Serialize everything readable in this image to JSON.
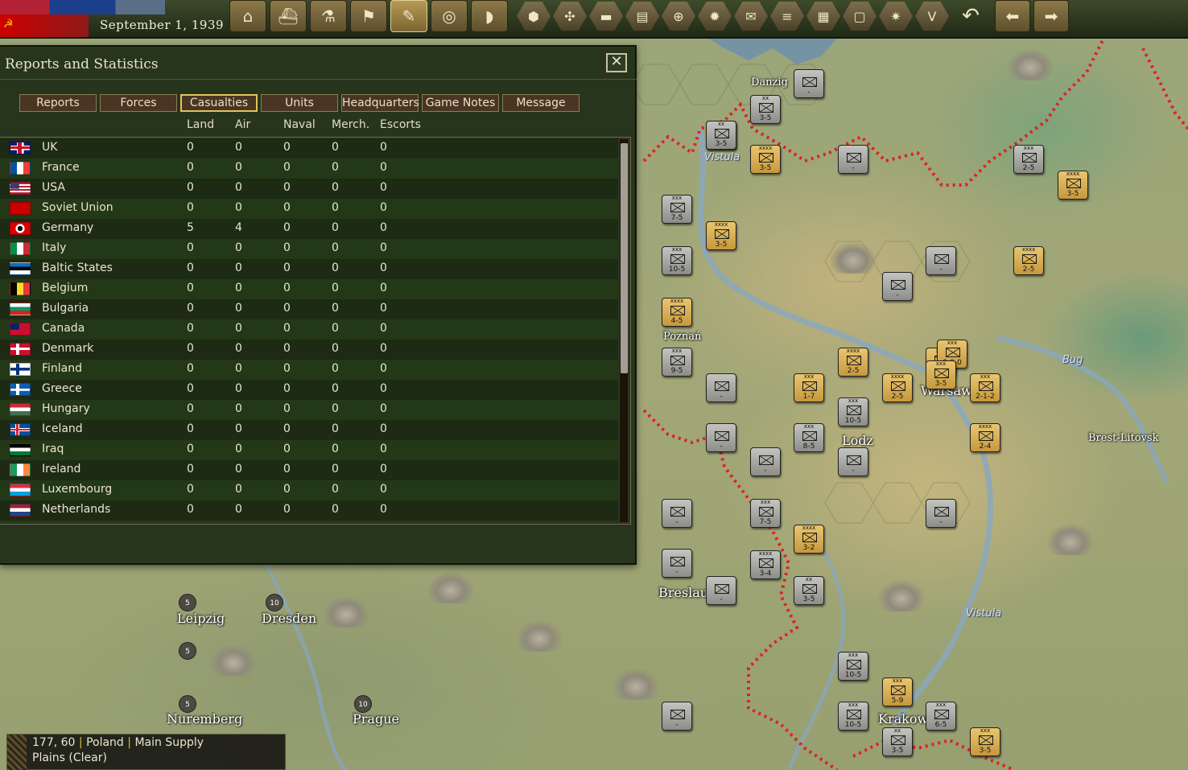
{
  "header": {
    "date": "September 1, 1939",
    "toolbar": [
      {
        "name": "production-button",
        "icon": "factory-icon",
        "glyph": "⌂"
      },
      {
        "name": "diplomacy-button",
        "icon": "ship-icon",
        "glyph": "⛴"
      },
      {
        "name": "research-button",
        "icon": "microscope-icon",
        "glyph": "⚗"
      },
      {
        "name": "objectives-button",
        "icon": "flag-icon",
        "glyph": "⚑"
      },
      {
        "name": "reports-button",
        "icon": "notepad-icon",
        "glyph": "✎"
      },
      {
        "name": "intelligence-button",
        "icon": "binoculars-icon",
        "glyph": "◎"
      },
      {
        "name": "units-button",
        "icon": "helmet-icon",
        "glyph": "◗"
      }
    ],
    "hex_tools": [
      {
        "name": "terrain-filter-button",
        "icon": "hex-icon",
        "glyph": "⬢"
      },
      {
        "name": "resources-filter-button",
        "icon": "hex-cluster-icon",
        "glyph": "✣"
      },
      {
        "name": "tank-filter-button",
        "icon": "tank-icon",
        "glyph": "▬"
      },
      {
        "name": "supply-filter-button",
        "icon": "supply-icon",
        "glyph": "▤"
      },
      {
        "name": "target-filter-button",
        "icon": "crosshair-icon",
        "glyph": "⊕"
      },
      {
        "name": "weather-filter-button",
        "icon": "sun-icon",
        "glyph": "✹"
      },
      {
        "name": "unit-filter-button",
        "icon": "envelope-icon",
        "glyph": "✉"
      },
      {
        "name": "rail-filter-button",
        "icon": "rail-icon",
        "glyph": "≡"
      },
      {
        "name": "grid-filter-button",
        "icon": "grid-icon",
        "glyph": "▦"
      },
      {
        "name": "frame-filter-button",
        "icon": "frame-icon",
        "glyph": "▢"
      },
      {
        "name": "combat-filter-button",
        "icon": "explosion-icon",
        "glyph": "✷"
      },
      {
        "name": "victory-filter-button",
        "icon": "victory-icon",
        "glyph": "V"
      }
    ]
  },
  "panel": {
    "title": "Reports and Statistics",
    "tabs": [
      "Reports",
      "Forces",
      "Casualties",
      "Units",
      "Headquarters",
      "Game Notes",
      "Message"
    ],
    "active_tab": "Casualties",
    "columns": [
      "Land",
      "Air",
      "Naval",
      "Merch.",
      "Escorts"
    ],
    "rows": [
      {
        "country": "UK",
        "flag": "uk",
        "values": [
          "0",
          "0",
          "0",
          "0",
          "0"
        ]
      },
      {
        "country": "France",
        "flag": "france",
        "values": [
          "0",
          "0",
          "0",
          "0",
          "0"
        ]
      },
      {
        "country": "USA",
        "flag": "usa",
        "values": [
          "0",
          "0",
          "0",
          "0",
          "0"
        ]
      },
      {
        "country": "Soviet Union",
        "flag": "ussr",
        "values": [
          "0",
          "0",
          "0",
          "0",
          "0"
        ]
      },
      {
        "country": "Germany",
        "flag": "germany",
        "values": [
          "5",
          "4",
          "0",
          "0",
          "0"
        ]
      },
      {
        "country": "Italy",
        "flag": "italy",
        "values": [
          "0",
          "0",
          "0",
          "0",
          "0"
        ]
      },
      {
        "country": "Baltic States",
        "flag": "baltic",
        "values": [
          "0",
          "0",
          "0",
          "0",
          "0"
        ]
      },
      {
        "country": "Belgium",
        "flag": "belgium",
        "values": [
          "0",
          "0",
          "0",
          "0",
          "0"
        ]
      },
      {
        "country": "Bulgaria",
        "flag": "bulgaria",
        "values": [
          "0",
          "0",
          "0",
          "0",
          "0"
        ]
      },
      {
        "country": "Canada",
        "flag": "canada",
        "values": [
          "0",
          "0",
          "0",
          "0",
          "0"
        ]
      },
      {
        "country": "Denmark",
        "flag": "denmark",
        "values": [
          "0",
          "0",
          "0",
          "0",
          "0"
        ]
      },
      {
        "country": "Finland",
        "flag": "finland",
        "values": [
          "0",
          "0",
          "0",
          "0",
          "0"
        ]
      },
      {
        "country": "Greece",
        "flag": "greece",
        "values": [
          "0",
          "0",
          "0",
          "0",
          "0"
        ]
      },
      {
        "country": "Hungary",
        "flag": "hungary",
        "values": [
          "0",
          "0",
          "0",
          "0",
          "0"
        ]
      },
      {
        "country": "Iceland",
        "flag": "iceland",
        "values": [
          "0",
          "0",
          "0",
          "0",
          "0"
        ]
      },
      {
        "country": "Iraq",
        "flag": "iraq",
        "values": [
          "0",
          "0",
          "0",
          "0",
          "0"
        ]
      },
      {
        "country": "Ireland",
        "flag": "ireland",
        "values": [
          "0",
          "0",
          "0",
          "0",
          "0"
        ]
      },
      {
        "country": "Luxembourg",
        "flag": "luxembourg",
        "values": [
          "0",
          "0",
          "0",
          "0",
          "0"
        ]
      },
      {
        "country": "Netherlands",
        "flag": "netherlands",
        "values": [
          "0",
          "0",
          "0",
          "0",
          "0"
        ]
      }
    ]
  },
  "flag_colors": {
    "uk": "linear-gradient(#c8102e 0 0) 50%/100% 22% no-repeat,linear-gradient(#c8102e 0 0) 50%/22% 100% no-repeat,linear-gradient(#fff 0 0) 50%/100% 40% no-repeat,linear-gradient(#fff 0 0) 50%/36% 100% no-repeat,#012169",
    "france": "linear-gradient(90deg,#0055a4 0 33%,#fff 33% 66%,#ef4135 66%)",
    "usa": "linear-gradient(#3c3b6e 0 0) 0 0/45% 55% no-repeat,repeating-linear-gradient(180deg,#b22234 0 2px,#fff 2px 4px)",
    "ussr": "#cc0000",
    "germany": "radial-gradient(circle,#000 0 22%,#fff 23% 40%,#d00 41%)",
    "italy": "linear-gradient(90deg,#009246 0 33%,#fff 33% 66%,#ce2b37 66%)",
    "baltic": "linear-gradient(180deg,#0072ce 0 33%,#000 33% 66%,#fff 66%)",
    "belgium": "linear-gradient(90deg,#000 0 33%,#fdda24 33% 66%,#ef3340 66%)",
    "bulgaria": "linear-gradient(180deg,#fff 0 33%,#00966e 33% 66%,#d62612 66%)",
    "canada": "linear-gradient(#012169 0 0) 0 0/45% 55% no-repeat,#c8102e",
    "denmark": "linear-gradient(#fff 0 0) 0 50%/100% 22% no-repeat,linear-gradient(#fff 0 0) 35% 0/16% 100% no-repeat,#c8102e",
    "finland": "linear-gradient(#003580 0 0) 0 50%/100% 26% no-repeat,linear-gradient(#003580 0 0) 35% 0/18% 100% no-repeat,#fff",
    "greece": "linear-gradient(#fff 0 0) 0 50%/100% 20% no-repeat,linear-gradient(#fff 0 0) 35% 0/18% 100% no-repeat,#0d5eaf",
    "hungary": "linear-gradient(180deg,#ce2939 0 33%,#fff 33% 66%,#477050 66%)",
    "iceland": "linear-gradient(#dc1e35 0 0) 0 50%/100% 16% no-repeat,linear-gradient(#dc1e35 0 0) 35% 0/12% 100% no-repeat,linear-gradient(#fff 0 0) 0 50%/100% 30% no-repeat,linear-gradient(#fff 0 0) 33% 0/22% 100% no-repeat,#02529c",
    "iraq": "linear-gradient(180deg,#000 0 33%,#fff 33% 66%,#007a3d 66%)",
    "ireland": "linear-gradient(90deg,#169b62 0 33%,#fff 33% 66%,#ff883e 66%)",
    "luxembourg": "linear-gradient(180deg,#ed2939 0 33%,#fff 33% 66%,#00a1de 66%)",
    "netherlands": "linear-gradient(180deg,#ae1c28 0 33%,#fff 33% 66%,#21468b 66%)"
  },
  "status": {
    "coords": "177, 60",
    "region": "Poland",
    "supply": "Main Supply",
    "terrain": "Plains (Clear)"
  },
  "map": {
    "cities": [
      "Danzig",
      "Poznań",
      "Warsaw",
      "Lodz",
      "Breslau",
      "Krakow",
      "Brest-Litovsk",
      "Leipzig",
      "Dresden",
      "Nuremberg",
      "Prague"
    ],
    "rivers": [
      "Vistula",
      "Bug",
      "Vistula"
    ],
    "resources": [
      "5",
      "10",
      "5",
      "5",
      "10"
    ],
    "units": [
      {
        "side": "g",
        "size": "xx",
        "str": "3-5"
      },
      {
        "side": "y",
        "size": "xxxx",
        "str": "3-5"
      },
      {
        "side": "g",
        "size": "",
        "str": "-"
      },
      {
        "side": "g",
        "size": "xx",
        "str": "3-5"
      },
      {
        "side": "g",
        "size": "",
        "str": "-"
      },
      {
        "side": "g",
        "size": "xxx",
        "str": "7-5"
      },
      {
        "side": "y",
        "size": "xxxx",
        "str": "3-5"
      },
      {
        "side": "g",
        "size": "xxx",
        "str": "10-5"
      },
      {
        "side": "y",
        "size": "xxxx",
        "str": "4-5"
      },
      {
        "side": "g",
        "size": "xxx",
        "str": "9-5"
      },
      {
        "side": "g",
        "size": "",
        "str": "-"
      },
      {
        "side": "y",
        "size": "xxx",
        "str": "1-7"
      },
      {
        "side": "y",
        "size": "xxxx",
        "str": "2-5"
      },
      {
        "side": "g",
        "size": "xxx",
        "str": "10-5"
      },
      {
        "side": "y",
        "size": "xxxx",
        "str": "2-5"
      },
      {
        "side": "y",
        "size": "xxx",
        "str": "3-5"
      },
      {
        "side": "y",
        "size": "xxx",
        "str": "2-1-2"
      },
      {
        "side": "y",
        "size": "xxxx",
        "str": "2-4"
      },
      {
        "side": "g",
        "size": "",
        "str": "-"
      },
      {
        "side": "g",
        "size": "",
        "str": "-"
      },
      {
        "side": "g",
        "size": "xxx",
        "str": "8-5"
      },
      {
        "side": "g",
        "size": "",
        "str": "-"
      },
      {
        "side": "g",
        "size": "",
        "str": "-"
      },
      {
        "side": "g",
        "size": "xxx",
        "str": "7-5"
      },
      {
        "side": "y",
        "size": "xxxx",
        "str": "3-2"
      },
      {
        "side": "g",
        "size": "",
        "str": "-"
      },
      {
        "side": "g",
        "size": "xxxx",
        "str": "3-4"
      },
      {
        "side": "g",
        "size": "xx",
        "str": "3-5"
      },
      {
        "side": "g",
        "size": "",
        "str": "-"
      },
      {
        "side": "g",
        "size": "",
        "str": "-"
      },
      {
        "side": "g",
        "size": "xxx",
        "str": "10-5"
      },
      {
        "side": "y",
        "size": "xxx",
        "str": "5-9"
      },
      {
        "side": "g",
        "size": "xxx",
        "str": "10-5"
      },
      {
        "side": "g",
        "size": "xxx",
        "str": "6-5"
      },
      {
        "side": "g",
        "size": "xx",
        "str": "3-5"
      },
      {
        "side": "y",
        "size": "xxx",
        "str": "3-5"
      },
      {
        "side": "g",
        "size": "",
        "str": "-"
      },
      {
        "side": "g",
        "size": "xx",
        "str": "3-5"
      },
      {
        "side": "g",
        "size": "xxx",
        "str": "2-5"
      },
      {
        "side": "y",
        "size": "xxxx",
        "str": "3-5"
      },
      {
        "side": "y",
        "size": "xxxx",
        "str": "2-5"
      },
      {
        "side": "g",
        "size": "",
        "str": "-"
      },
      {
        "side": "g",
        "size": "",
        "str": "-"
      },
      {
        "side": "y",
        "size": "xxx",
        "str": "0-0-0"
      },
      {
        "side": "y",
        "size": "xxx",
        "str": "3-5"
      }
    ]
  }
}
